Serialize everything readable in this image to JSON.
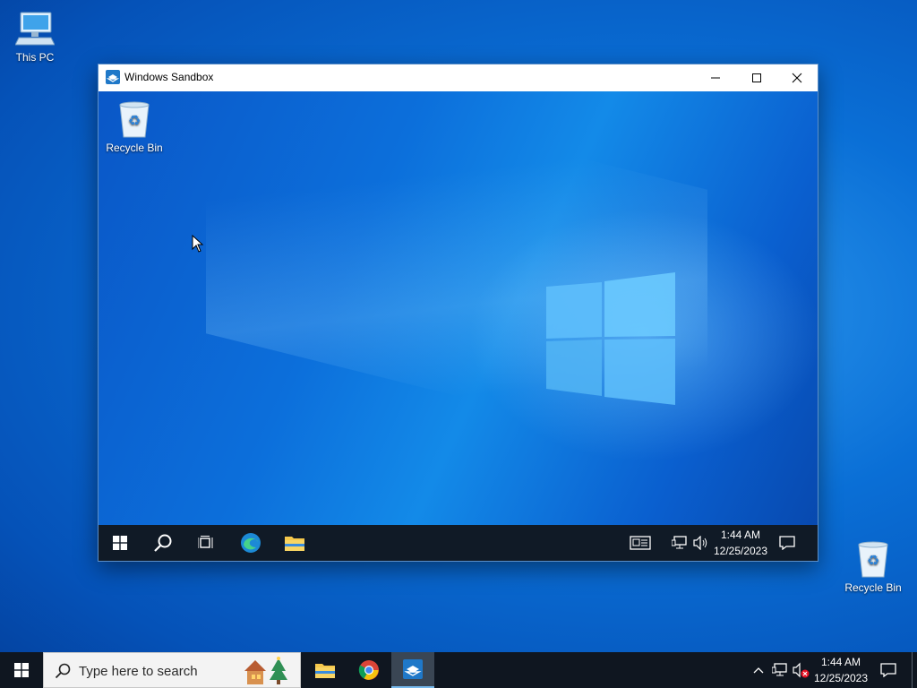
{
  "host_desktop": {
    "this_pc_label": "This PC",
    "recycle_bin_label": "Recycle Bin"
  },
  "sandbox_window": {
    "title": "Windows Sandbox",
    "inner_desktop": {
      "recycle_bin_label": "Recycle Bin"
    },
    "inner_taskbar": {
      "time": "1:44 AM",
      "date": "12/25/2023"
    }
  },
  "taskbar": {
    "search_placeholder": "Type here to search",
    "time": "1:44 AM",
    "date": "12/25/2023"
  },
  "colors": {
    "accent": "#76b9ed",
    "taskbar": "#0f1620",
    "desktop": "#0a6fd6"
  },
  "icons": [
    "start-icon",
    "search-icon",
    "task-view-icon",
    "edge-icon",
    "file-explorer-icon",
    "chrome-icon",
    "sandbox-icon",
    "news-icon",
    "network-icon",
    "volume-icon",
    "notification-icon"
  ]
}
